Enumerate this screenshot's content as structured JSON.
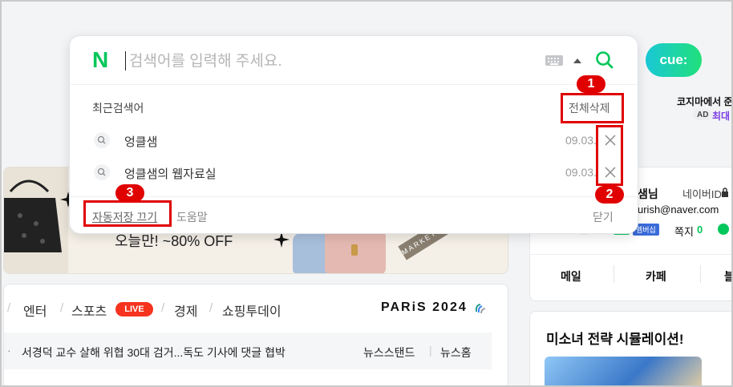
{
  "search": {
    "placeholder": "검색어를 입력해 주세요.",
    "recent_title": "최근검색어",
    "clear_all": "전체삭제",
    "items": [
      {
        "term": "엉클샘",
        "date": "09.03."
      },
      {
        "term": "엉클샘의 웹자료실",
        "date": "09.03."
      }
    ],
    "footer": {
      "auto_save_off": "자동저장 끄기",
      "help": "도움말",
      "close": "닫기"
    }
  },
  "annotations": {
    "marker1": "1",
    "marker2": "2",
    "marker3": "3"
  },
  "ad": {
    "title": "코지마에서 준",
    "badge": "AD",
    "text": "최대"
  },
  "cue": {
    "label": "cue:"
  },
  "banner": {
    "text": "오늘만! ~80% OFF",
    "tape_text": "MARKET BIGSALE · GMA"
  },
  "news": {
    "tabs": [
      "엔터",
      "스포츠",
      "경제",
      "쇼핑투데이"
    ],
    "live_badge": "LIVE",
    "paris": "PARiS 2024",
    "headline": "서경덕 교수 살해 위협 30대 검거...독도 기사에 댓글 협박",
    "newsstand": "뉴스스탠드",
    "newshome": "뉴스홈"
  },
  "profile": {
    "name": "샘님",
    "id_label": "네이버ID",
    "email": "urish@naver.com",
    "membership": "멤버십",
    "message_label": "쪽지",
    "message_count": "0",
    "menu": [
      "메일",
      "카페",
      "블"
    ]
  },
  "game": {
    "title": "미소녀 전략 시뮬레이션!"
  },
  "colors": {
    "naver_green": "#03c75a",
    "annotation_red": "#e00000",
    "live_red": "#f5331f"
  }
}
